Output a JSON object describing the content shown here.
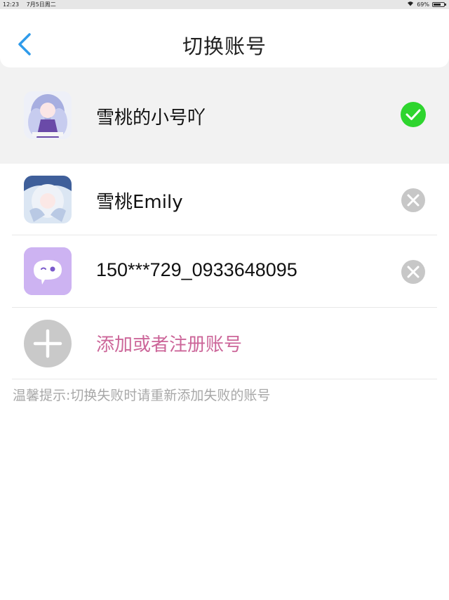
{
  "status_bar": {
    "time": "12:23",
    "date": "7月5日周二",
    "battery": "69%",
    "battery_level": 0.69
  },
  "header": {
    "title": "切换账号",
    "back_icon": "chevron-left-icon",
    "accent": "#2f9bea"
  },
  "current_account": {
    "name": "雪桃的小号吖",
    "status_icon": "check-icon",
    "status_color": "#2ed52e"
  },
  "accounts": [
    {
      "name": "雪桃Emily",
      "action_icon": "close-icon"
    },
    {
      "name": "150***729_0933648095",
      "action_icon": "close-icon"
    }
  ],
  "add_account": {
    "label": "添加或者注册账号",
    "icon": "plus-icon",
    "color": "#cc6699"
  },
  "hint": "温馨提示:切换失败时请重新添加失败的账号"
}
